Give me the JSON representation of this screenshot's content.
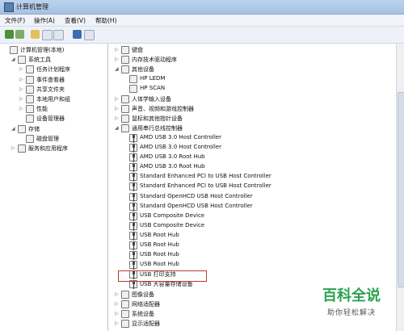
{
  "window": {
    "title": "计算机管理"
  },
  "menu": [
    "文件(F)",
    "操作(A)",
    "查看(V)",
    "帮助(H)"
  ],
  "left_tree": [
    {
      "label": "计算机管理(本地)",
      "level": 0,
      "exp": ""
    },
    {
      "label": "系统工具",
      "level": 1,
      "exp": "◢"
    },
    {
      "label": "任务计划程序",
      "level": 2,
      "exp": "▷"
    },
    {
      "label": "事件查看器",
      "level": 2,
      "exp": "▷"
    },
    {
      "label": "共享文件夹",
      "level": 2,
      "exp": "▷"
    },
    {
      "label": "本地用户和组",
      "level": 2,
      "exp": "▷"
    },
    {
      "label": "性能",
      "level": 2,
      "exp": "▷"
    },
    {
      "label": "设备管理器",
      "level": 2,
      "exp": ""
    },
    {
      "label": "存储",
      "level": 1,
      "exp": "◢"
    },
    {
      "label": "磁盘管理",
      "level": 2,
      "exp": ""
    },
    {
      "label": "服务和应用程序",
      "level": 1,
      "exp": "▷"
    }
  ],
  "device_tree": [
    {
      "label": "键盘",
      "level": 0,
      "exp": "▷"
    },
    {
      "label": "内存技术驱动程序",
      "level": 0,
      "exp": "▷"
    },
    {
      "label": "其他设备",
      "level": 0,
      "exp": "◢"
    },
    {
      "label": "HP LEDM",
      "level": 1,
      "exp": ""
    },
    {
      "label": "HP SCAN",
      "level": 1,
      "exp": ""
    },
    {
      "label": "人体学输入设备",
      "level": 0,
      "exp": "▷"
    },
    {
      "label": "声音、视频和游戏控制器",
      "level": 0,
      "exp": "▷"
    },
    {
      "label": "鼠标和其他指针设备",
      "level": 0,
      "exp": "▷"
    },
    {
      "label": "通用串行总线控制器",
      "level": 0,
      "exp": "◢"
    },
    {
      "label": "AMD USB 3.0 Host Controller",
      "level": 1,
      "exp": "",
      "usb": true
    },
    {
      "label": "AMD USB 3.0 Host Controller",
      "level": 1,
      "exp": "",
      "usb": true
    },
    {
      "label": "AMD USB 3.0 Root Hub",
      "level": 1,
      "exp": "",
      "usb": true
    },
    {
      "label": "AMD USB 3.0 Root Hub",
      "level": 1,
      "exp": "",
      "usb": true
    },
    {
      "label": "Standard Enhanced PCI to USB Host Controller",
      "level": 1,
      "exp": "",
      "usb": true
    },
    {
      "label": "Standard Enhanced PCI to USB Host Controller",
      "level": 1,
      "exp": "",
      "usb": true
    },
    {
      "label": "Standard OpenHCD USB Host Controller",
      "level": 1,
      "exp": "",
      "usb": true
    },
    {
      "label": "Standard OpenHCD USB Host Controller",
      "level": 1,
      "exp": "",
      "usb": true
    },
    {
      "label": "USB Composite Device",
      "level": 1,
      "exp": "",
      "usb": true
    },
    {
      "label": "USB Composite Device",
      "level": 1,
      "exp": "",
      "usb": true
    },
    {
      "label": "USB Root Hub",
      "level": 1,
      "exp": "",
      "usb": true
    },
    {
      "label": "USB Root Hub",
      "level": 1,
      "exp": "",
      "usb": true
    },
    {
      "label": "USB Root Hub",
      "level": 1,
      "exp": "",
      "usb": true
    },
    {
      "label": "USB Root Hub",
      "level": 1,
      "exp": "",
      "usb": true
    },
    {
      "label": "USB 打印支持",
      "level": 1,
      "exp": "",
      "usb": true
    },
    {
      "label": "USB 大容量存储设备",
      "level": 1,
      "exp": "",
      "usb": true
    },
    {
      "label": "图像设备",
      "level": 0,
      "exp": "▷"
    },
    {
      "label": "网络适配器",
      "level": 0,
      "exp": "▷"
    },
    {
      "label": "系统设备",
      "level": 0,
      "exp": "▷"
    },
    {
      "label": "显示适配器",
      "level": 0,
      "exp": "▷"
    }
  ],
  "watermark": {
    "title": "百科全说",
    "subtitle": "助你轻松解决"
  }
}
